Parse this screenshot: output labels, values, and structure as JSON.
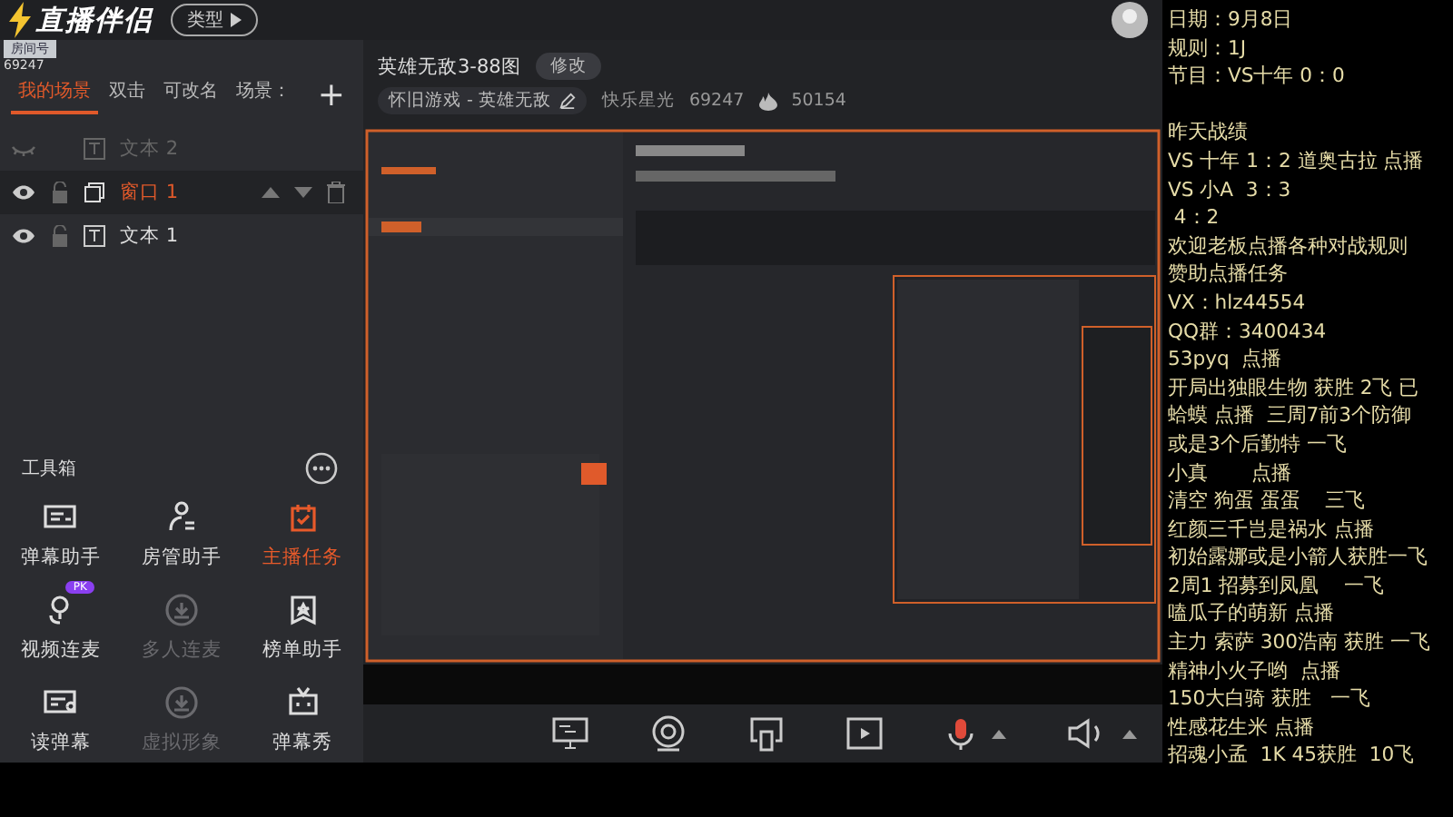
{
  "app": {
    "logo": "直播伴侣",
    "type_button": "类型",
    "room_label": "房间号",
    "room_number": "69247"
  },
  "scene_tabs": [
    {
      "label": "我的场景",
      "selected": true
    },
    {
      "label": "双击",
      "selected": false
    },
    {
      "label": "可改名",
      "selected": false
    },
    {
      "label": "场景：",
      "selected": false
    }
  ],
  "add_scene": "+",
  "layers": [
    {
      "kind": "text",
      "name": "文本 2",
      "visible": false,
      "selected": false
    },
    {
      "kind": "window",
      "name": "窗口 1",
      "visible": true,
      "selected": true
    },
    {
      "kind": "text",
      "name": "文本 1",
      "visible": true,
      "selected": false
    }
  ],
  "toolbox": {
    "title": "工具箱",
    "tools": [
      {
        "label": "弹幕助手",
        "highlighted": false,
        "disabled": false
      },
      {
        "label": "房管助手",
        "highlighted": false,
        "disabled": false
      },
      {
        "label": "主播任务",
        "highlighted": true,
        "disabled": false
      },
      {
        "label": "视频连麦",
        "highlighted": false,
        "disabled": false,
        "badge": "PK"
      },
      {
        "label": "多人连麦",
        "highlighted": false,
        "disabled": true
      },
      {
        "label": "榜单助手",
        "highlighted": false,
        "disabled": false
      },
      {
        "label": "读弹幕",
        "highlighted": false,
        "disabled": false
      },
      {
        "label": "虚拟形象",
        "highlighted": false,
        "disabled": true
      },
      {
        "label": "弹幕秀",
        "highlighted": false,
        "disabled": false
      }
    ]
  },
  "stream": {
    "title": "英雄无敌3-88图",
    "edit_button": "修改",
    "category": "怀旧游戏 - 英雄无敌",
    "nickname": "快乐星光",
    "user_id": "69247",
    "popularity": "50154"
  },
  "overlay": {
    "header_lines": [
      "日期：9月8日",
      "规则：1J",
      "节目：VS十年 0：0"
    ],
    "lines": [
      "昨天战绩",
      "VS 十年 1：2 道奥古拉 点播",
      "VS 小A  3：3",
      " 4：2",
      "欢迎老板点播各种对战规则",
      "赞助点播任务",
      "VX：hlz44554",
      "QQ群：3400434",
      "53pyq  点播",
      "开局出独眼生物 获胜 2飞 已",
      "蛤蟆 点播  三周7前3个防御",
      "或是3个后勤特 一飞",
      "小真       点播",
      "清空 狗蛋 蛋蛋    三飞",
      "红颜三千岂是祸水 点播",
      "初始露娜或是小箭人获胜一飞",
      "2周1 招募到凤凰    一飞",
      "嗑瓜子的萌新 点播",
      "主力 索萨 300浩南 获胜 一飞",
      "精神小火子哟  点播",
      "150大白骑 获胜   一飞",
      "性感花生米 点播",
      "招魂小孟  1K 45获胜  10飞"
    ]
  }
}
